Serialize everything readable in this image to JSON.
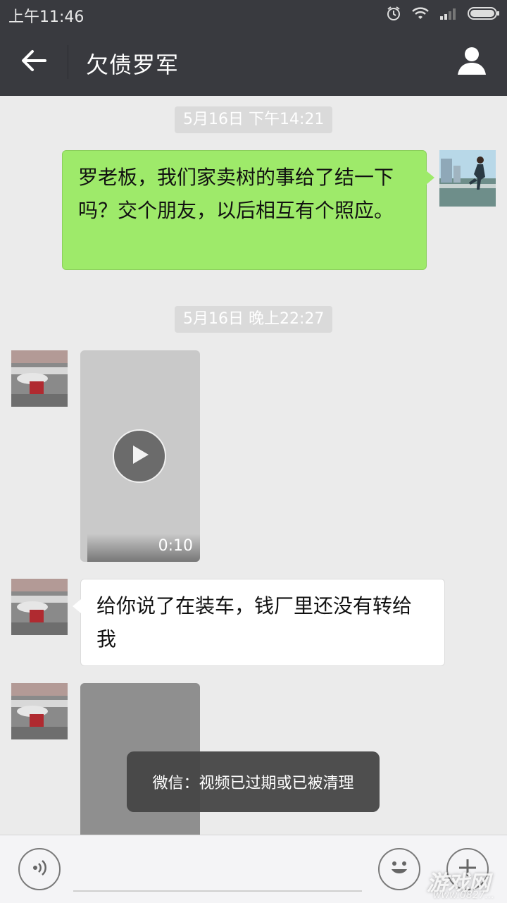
{
  "status_bar": {
    "time": "上午11:46"
  },
  "header": {
    "title": "欠债罗军"
  },
  "chat": {
    "timestamp_1": "5月16日 下午14:21",
    "message_1": "罗老板，我们家卖树的事给了结一下吗？交个朋友，以后相互有个照应。",
    "timestamp_2": "5月16日 晚上22:27",
    "video_1_duration": "0:10",
    "message_2": "给你说了在装车，钱厂里还没有转给我"
  },
  "toast": {
    "text": "微信：视频已过期或已被清理"
  },
  "watermark": {
    "text": "游戏网",
    "sub": "www.0827..."
  },
  "colors": {
    "header_bg": "#393a3f",
    "chat_bg": "#ebebeb",
    "sent_bubble": "#9eea6a",
    "received_bubble": "#ffffff"
  },
  "icons": {
    "back": "back-arrow-icon",
    "profile": "person-icon",
    "voice": "voice-icon",
    "emoji": "emoji-icon",
    "more": "plus-icon",
    "play": "play-icon"
  }
}
